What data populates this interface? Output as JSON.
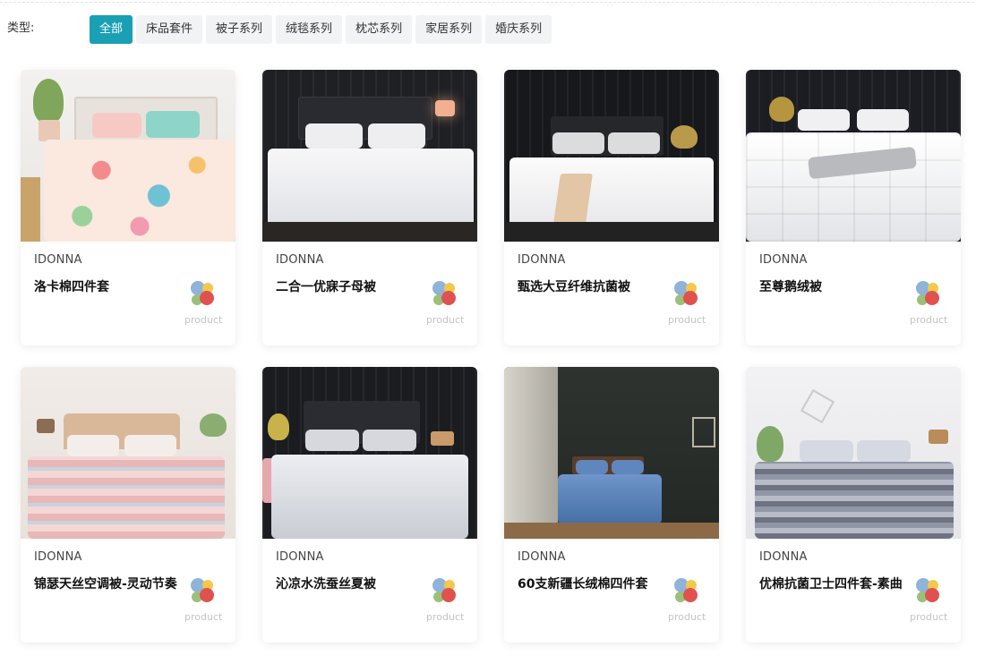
{
  "filter": {
    "label": "类型:",
    "tabs": [
      {
        "label": "全部",
        "active": true
      },
      {
        "label": "床品套件",
        "active": false
      },
      {
        "label": "被子系列",
        "active": false
      },
      {
        "label": "绒毯系列",
        "active": false
      },
      {
        "label": "枕芯系列",
        "active": false
      },
      {
        "label": "家居系列",
        "active": false
      },
      {
        "label": "婚庆系列",
        "active": false
      }
    ]
  },
  "products": [
    {
      "brand": "IDONNA",
      "title": "洛卡棉四件套",
      "logo_text": "product"
    },
    {
      "brand": "IDONNA",
      "title": "二合一优寐子母被",
      "logo_text": "product"
    },
    {
      "brand": "IDONNA",
      "title": "甄选大豆纤维抗菌被",
      "logo_text": "product"
    },
    {
      "brand": "IDONNA",
      "title": "至尊鹅绒被",
      "logo_text": "product"
    },
    {
      "brand": "IDONNA",
      "title": "锦瑟天丝空调被-灵动节奏",
      "logo_text": "product"
    },
    {
      "brand": "IDONNA",
      "title": "沁凉水洗蚕丝夏被",
      "logo_text": "product"
    },
    {
      "brand": "IDONNA",
      "title": "60支新疆长绒棉四件套",
      "logo_text": "product"
    },
    {
      "brand": "IDONNA",
      "title": "优棉抗菌卫士四件套-素曲",
      "logo_text": "product"
    }
  ],
  "colors": {
    "accent": "#19a0b4",
    "tab_bg": "#f2f3f5",
    "logo_blue": "#8fb3d9",
    "logo_yellow": "#f2c94c",
    "logo_green": "#9bc07a",
    "logo_red": "#e0524f"
  }
}
